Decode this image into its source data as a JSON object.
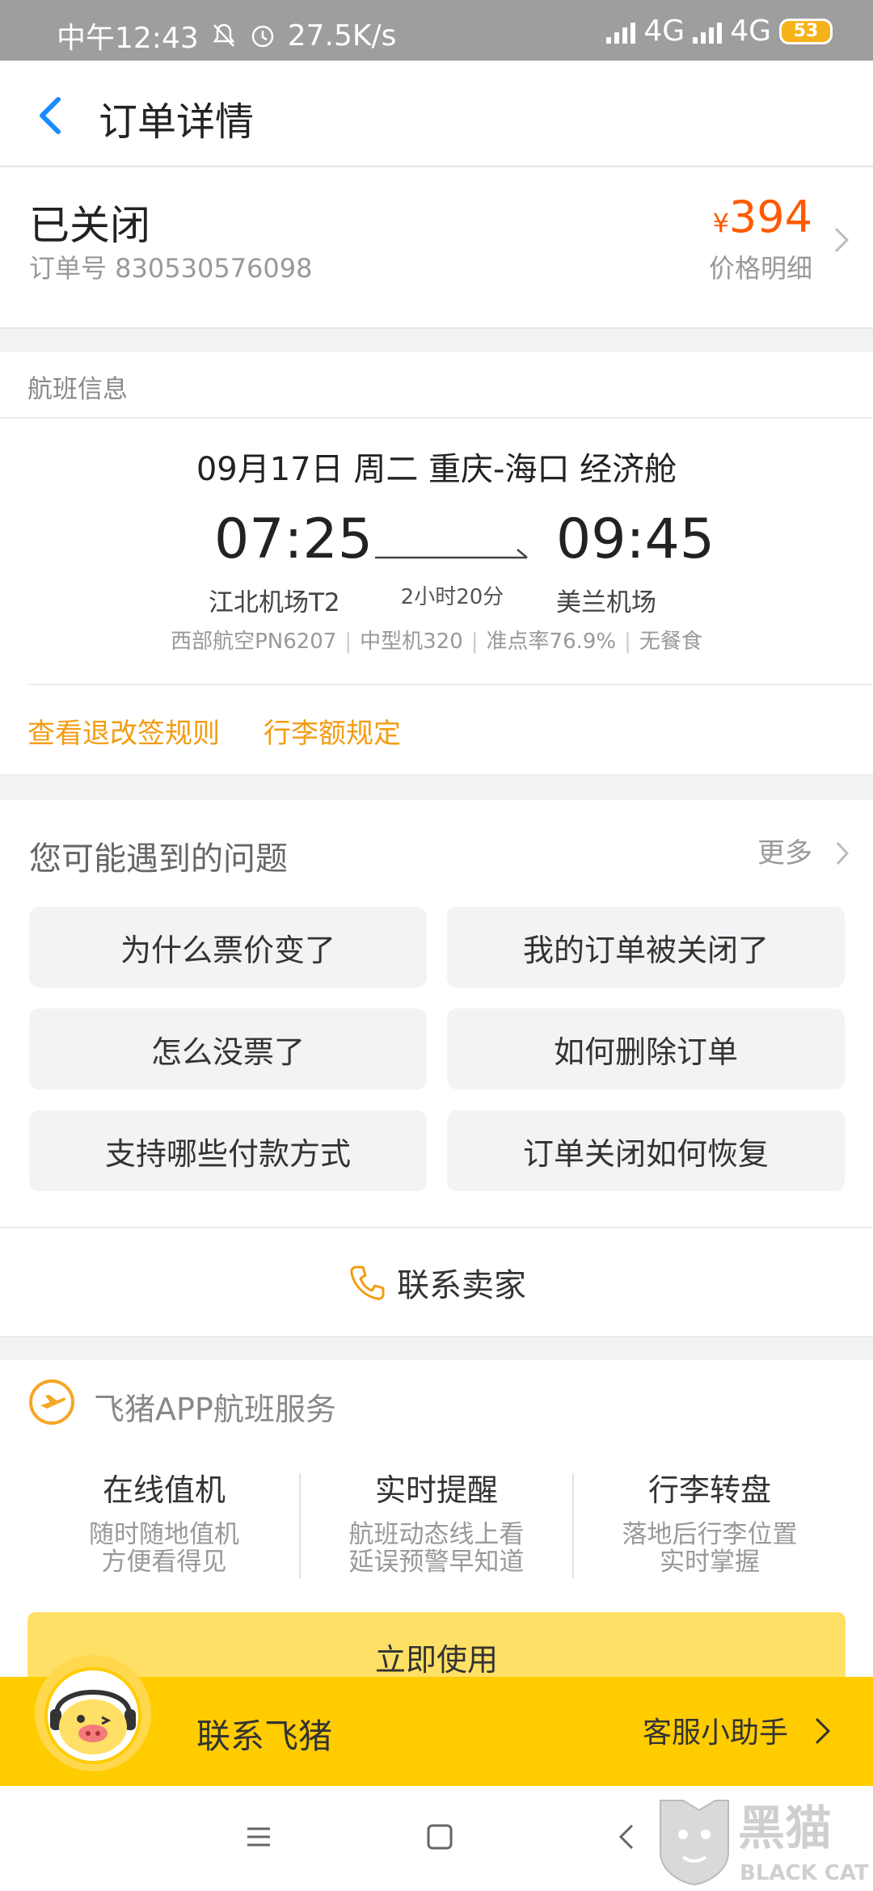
{
  "status_bar": {
    "time": "中午12:43",
    "speed": "27.5K/s",
    "net1": "4G",
    "net2": "4G",
    "battery": "53"
  },
  "header": {
    "title": "订单详情"
  },
  "order": {
    "status": "已关闭",
    "order_no": "订单号 830530576098",
    "currency": "¥",
    "price": "394",
    "price_detail": "价格明细"
  },
  "flight_section": {
    "title": "航班信息"
  },
  "flight": {
    "date_line": "09月17日 周二 重庆-海口 经济舱",
    "dep_time": "07:25",
    "arr_time": "09:45",
    "duration": "2小时20分",
    "dep_airport": "江北机场T2",
    "arr_airport": "美兰机场",
    "meta": [
      "西部航空PN6207",
      "中型机320",
      "准点率76.9%",
      "无餐食"
    ],
    "links": [
      "查看退改签规则",
      "行李额规定"
    ]
  },
  "faq": {
    "title": "您可能遇到的问题",
    "more": "更多",
    "items": [
      "为什么票价变了",
      "我的订单被关闭了",
      "怎么没票了",
      "如何删除订单",
      "支持哪些付款方式",
      "订单关闭如何恢复"
    ]
  },
  "contact": {
    "label": "联系卖家"
  },
  "service": {
    "title": "飞猪APP航班服务",
    "features": [
      {
        "title": "在线值机",
        "desc": "随时随地值机\n方便看得见"
      },
      {
        "title": "实时提醒",
        "desc": "航班动态线上看\n延误预警早知道"
      },
      {
        "title": "行李转盘",
        "desc": "落地后行李位置\n实时掌握"
      }
    ],
    "button": "立即使用"
  },
  "float_bar": {
    "left": "联系飞猪",
    "right": "客服小助手"
  },
  "watermark": {
    "cn": "黑猫",
    "en": "BLACK CAT"
  },
  "colors": {
    "accent": "#ff5a00",
    "link": "#f39c12",
    "brand_yellow": "#ffcc00",
    "back_blue": "#1a8cff"
  }
}
